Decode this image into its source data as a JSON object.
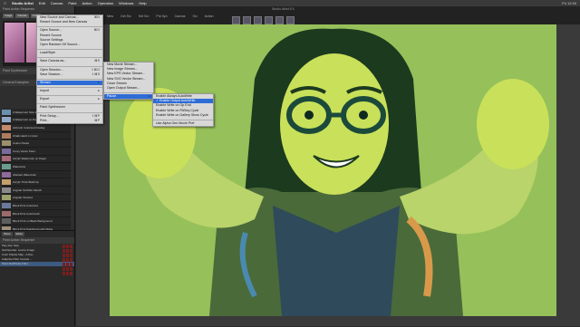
{
  "menubar": {
    "apple": "",
    "app": "Studio Artist",
    "items": [
      "Edit",
      "Canvas",
      "Paint",
      "Action",
      "Operation",
      "Windows",
      "Help"
    ],
    "right": "Fri 12:40"
  },
  "toolbar": {
    "doc_title": "Studio Artist 5.5",
    "icons": [
      "New",
      "Get Src",
      "Set Src",
      "Pnt Syn",
      "Canvas",
      "Src",
      "Action"
    ]
  },
  "left_panel": {
    "header": "Paint Action Sequence",
    "buttons": [
      "Image",
      "Canvas",
      "Color"
    ],
    "sub_header": "Paint Synthesizer",
    "list_header": "General Examples",
    "styles": [
      {
        "name": "A Watercolor Size Paintbrush",
        "color": "#6a8fb0"
      },
      {
        "name": "A Watercolor on Paper",
        "color": "#8fa7c4"
      },
      {
        "name": "Airbrush Colorized Fireday",
        "color": "#c28a6a"
      },
      {
        "name": "Chalk Hatch In Color",
        "color": "#b07a5e"
      },
      {
        "name": "Colour Pastel",
        "color": "#9c8f6a"
      },
      {
        "name": "Curvy Vector Paint",
        "color": "#7a6a9c"
      },
      {
        "name": "Acrylic Watercolor on Paper",
        "color": "#a66a7a"
      },
      {
        "name": "Watercolor",
        "color": "#6a9c8f"
      },
      {
        "name": "Abstract Watercolor",
        "color": "#8f6a9c"
      },
      {
        "name": "Acrylic Thick Build Up",
        "color": "#c2a06a"
      },
      {
        "name": "Angular Scribble Sketch",
        "color": "#8a8a8a"
      },
      {
        "name": "Angular Touched",
        "color": "#9ca06a"
      },
      {
        "name": "Block Print Colorized",
        "color": "#6a7a9c"
      },
      {
        "name": "Block Print Colorized2",
        "color": "#9c6a6a"
      },
      {
        "name": "Block Print on Black Background",
        "color": "#5e5e5e"
      },
      {
        "name": "Block Print Paintbrush with Ridge",
        "color": "#a08f7a"
      },
      {
        "name": "Boundary Octagon Stencil",
        "color": "#7a9c6a"
      },
      {
        "name": "Brush Stroke Vector",
        "color": "#8f7a6a"
      }
    ]
  },
  "bottom_panel": {
    "tabs": [
      "Show",
      "Editor"
    ],
    "header": "Paint Action Sequence",
    "rows": [
      {
        "label": "Play    Rec    Stop",
        "selected": false
      },
      {
        "label": "Set/Operate: source Image",
        "selected": false
      },
      {
        "label": "Color Palette Map - A Pal...",
        "selected": false
      },
      {
        "label": "Adaptive Filter Canvas ...",
        "selected": false
      },
      {
        "label": "Paint MultiScale Filter ...",
        "selected": true
      },
      {
        "label": "",
        "selected": false
      },
      {
        "label": "",
        "selected": false
      }
    ]
  },
  "file_menu": {
    "items": [
      {
        "label": "New Source and Canvas...",
        "shortcut": "⌘N"
      },
      {
        "label": "Recent Source and New Canvas",
        "shortcut": ""
      },
      {
        "label": "sep"
      },
      {
        "label": "Open Source...",
        "shortcut": "⌘O"
      },
      {
        "label": "Recent Source",
        "shortcut": ""
      },
      {
        "label": "Source Settings",
        "shortcut": ""
      },
      {
        "label": "Open Random Gif Source...",
        "shortcut": ""
      },
      {
        "label": "sep"
      },
      {
        "label": "Load/Style",
        "shortcut": ""
      },
      {
        "label": "sep"
      },
      {
        "label": "Save Canvas as...",
        "shortcut": "⌘S"
      },
      {
        "label": "sep"
      },
      {
        "label": "Open Session...",
        "shortcut": "⇧⌘O"
      },
      {
        "label": "Save Session...",
        "shortcut": "⇧⌘S"
      },
      {
        "label": "sep"
      },
      {
        "label": "Stream",
        "shortcut": "▸",
        "highlight": true
      },
      {
        "label": "sep"
      },
      {
        "label": "Import",
        "shortcut": "▸"
      },
      {
        "label": "sep"
      },
      {
        "label": "Export",
        "shortcut": "▸"
      },
      {
        "label": "sep"
      },
      {
        "label": "Paint Synthesizer",
        "shortcut": ""
      },
      {
        "label": "sep"
      },
      {
        "label": "Print Setup...",
        "shortcut": "⇧⌘P"
      },
      {
        "label": "Print...",
        "shortcut": "⌘P"
      }
    ]
  },
  "stream_menu": {
    "items": [
      {
        "label": "New Movie Stream...",
        "shortcut": ""
      },
      {
        "label": "New Image Stream...",
        "shortcut": ""
      },
      {
        "label": "New EPS Vector Stream...",
        "shortcut": ""
      },
      {
        "label": "New SVG Vector Stream...",
        "shortcut": ""
      },
      {
        "label": "Close Stream",
        "shortcut": ""
      },
      {
        "label": "Open Output Stream...",
        "shortcut": ""
      },
      {
        "label": "sep"
      },
      {
        "label": "Pause",
        "shortcut": "▸",
        "highlight": true
      }
    ]
  },
  "pause_menu": {
    "items": [
      {
        "label": "Enable Always AutoWrite",
        "shortcut": ""
      },
      {
        "label": "✓ Enable Output AutoWrite",
        "shortcut": "",
        "highlight": true
      },
      {
        "label": "Enable Write on Op End",
        "shortcut": ""
      },
      {
        "label": "Enable Write on PASeq Cycle",
        "shortcut": ""
      },
      {
        "label": "Enable Write on Gallery Show Cycle",
        "shortcut": ""
      },
      {
        "label": "sep"
      },
      {
        "label": "Use Alpha Gen Movie Pref",
        "shortcut": ""
      }
    ]
  },
  "canvas": {
    "background": "#96c05a",
    "skin": "#c9e05a",
    "hair": "#1c3a1e",
    "shirt": "#4a6a3a"
  }
}
